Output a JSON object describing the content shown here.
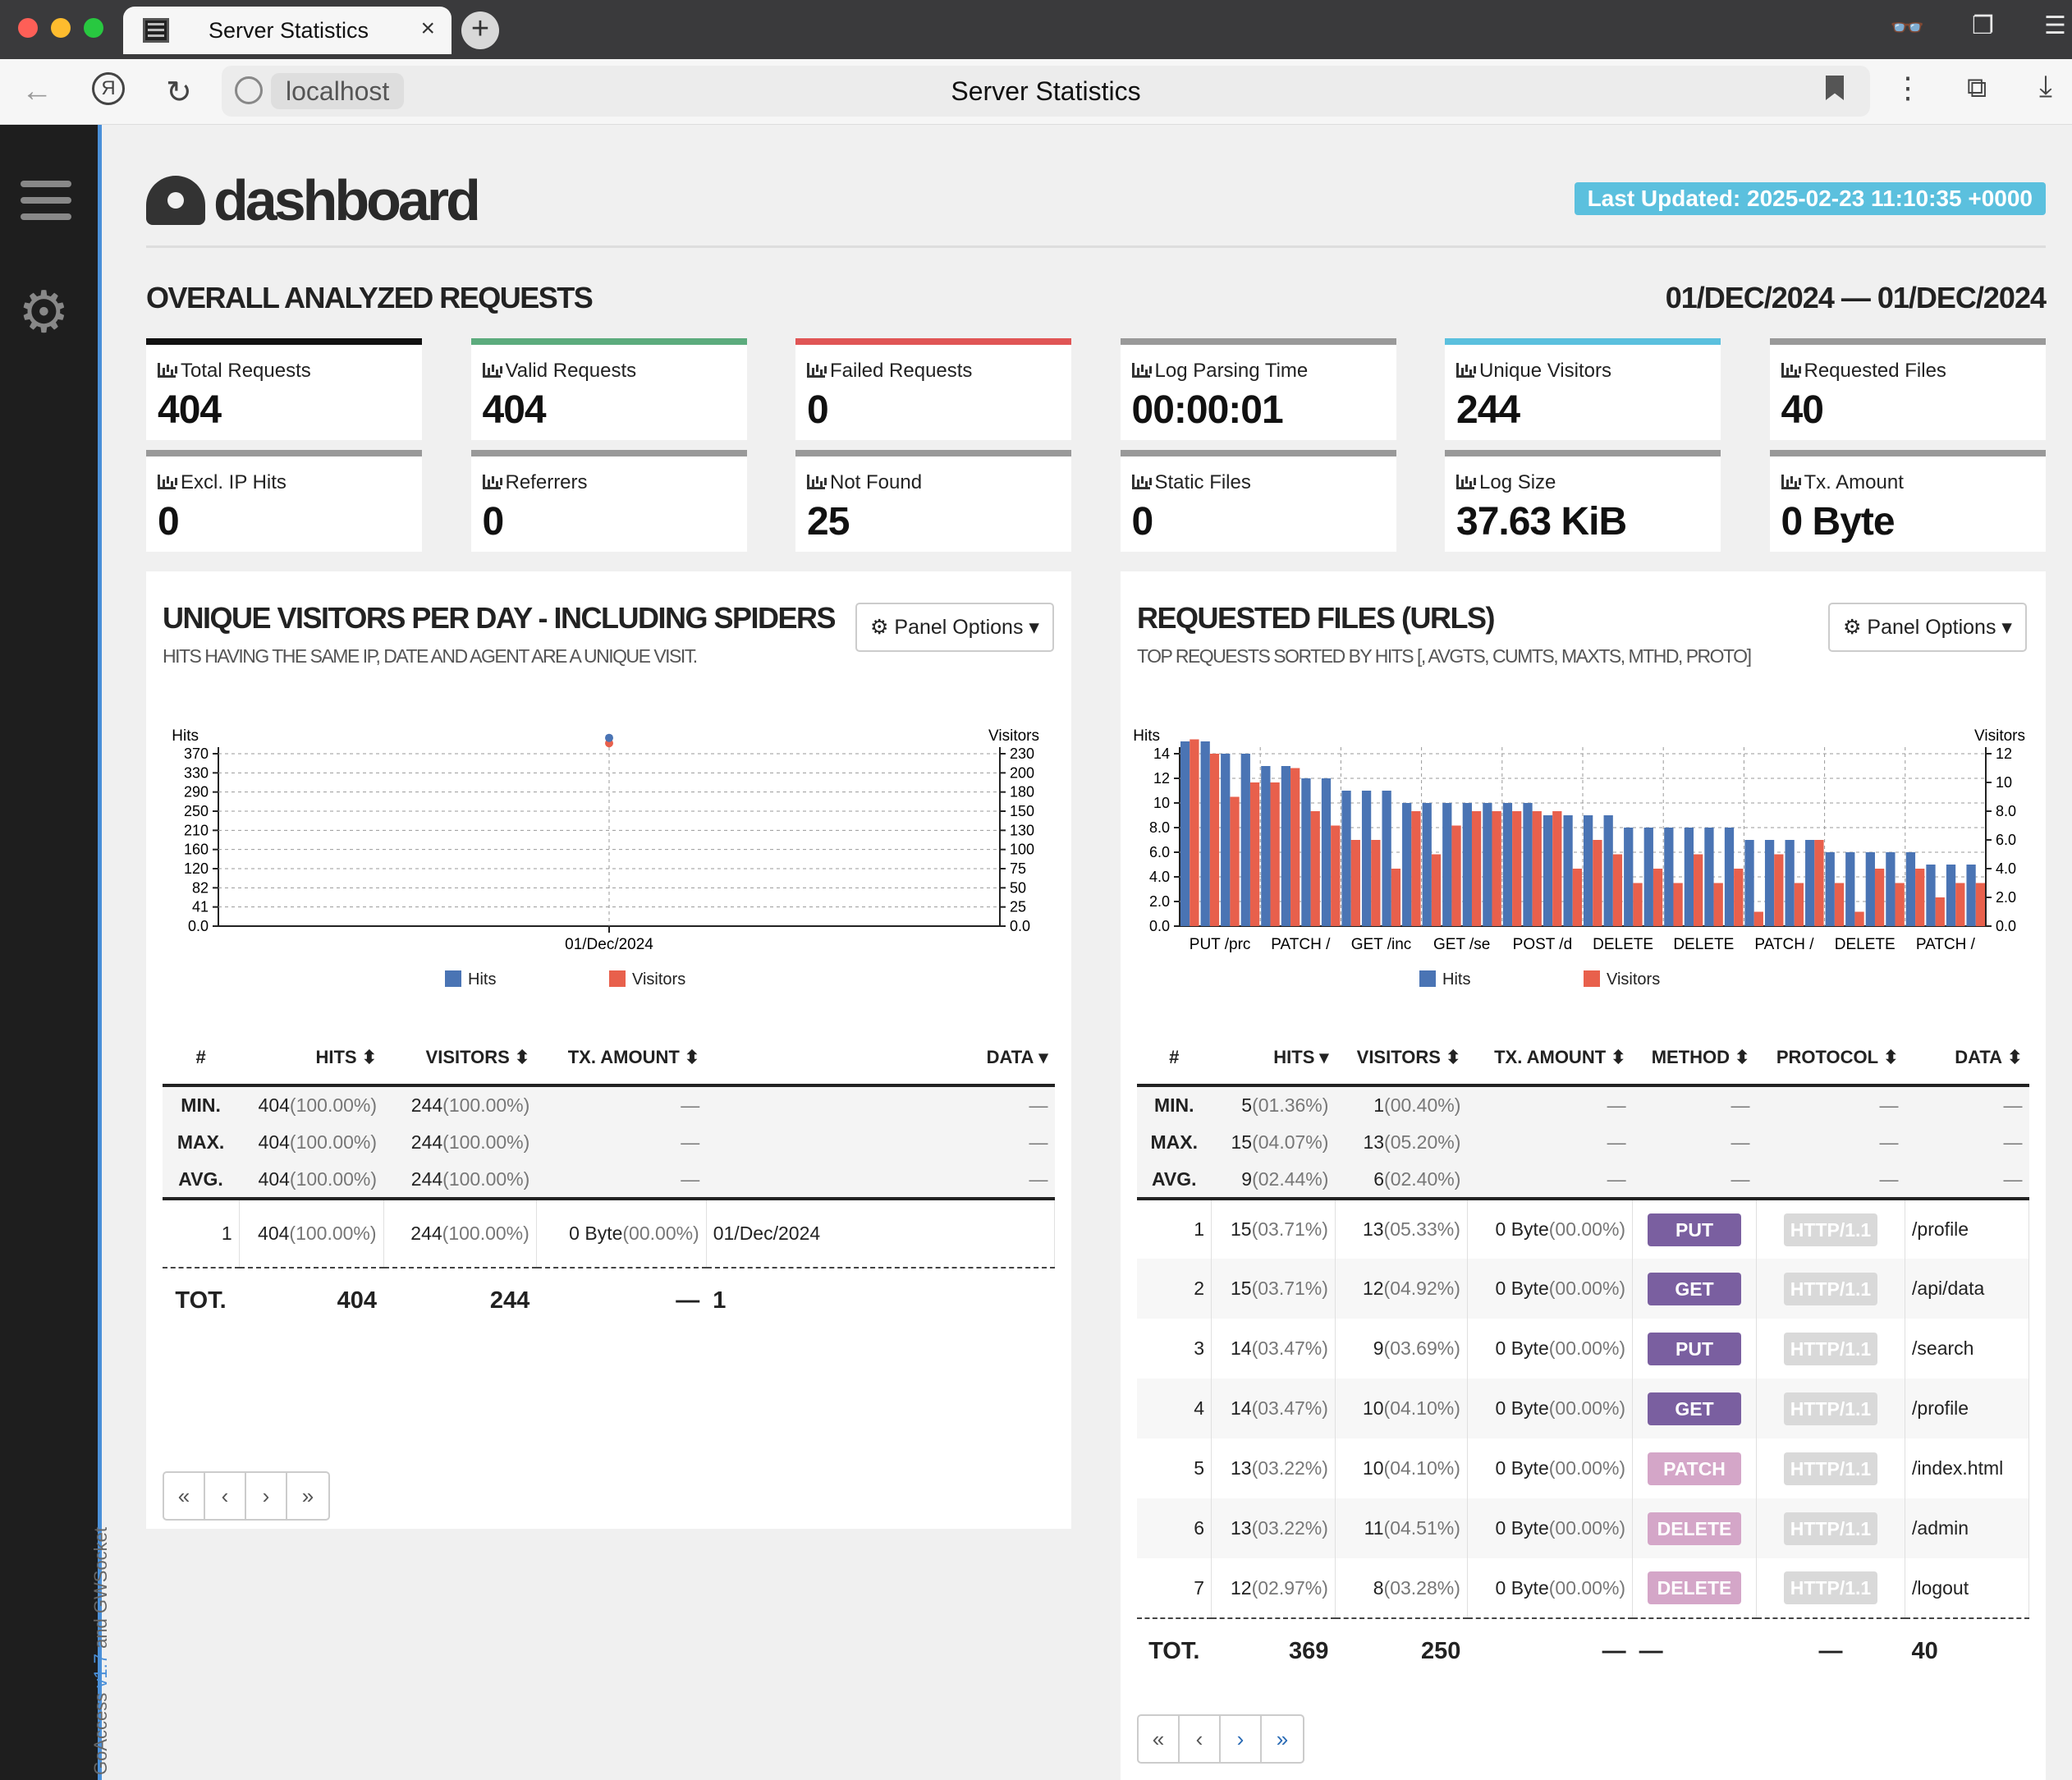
{
  "browser": {
    "tab_title": "Server Statistics",
    "tab_close": "×",
    "new_tab": "+",
    "url": "localhost",
    "page_title": "Server Statistics"
  },
  "sidebar": {
    "credit_prefix": "GoAccess ",
    "credit_version": "v1.7",
    "credit_suffix": " and GWSocket"
  },
  "header": {
    "logo_text": "dashboard",
    "last_updated": "Last Updated: 2025-02-23 11:10:35 +0000"
  },
  "overall": {
    "title": "OVERALL ANALYZED REQUESTS",
    "date_range": "01/DEC/2024 — 01/DEC/2024",
    "cards": [
      {
        "label": "Total Requests",
        "value": "404",
        "color": "#111111"
      },
      {
        "label": "Valid Requests",
        "value": "404",
        "color": "#5cab7d"
      },
      {
        "label": "Failed Requests",
        "value": "0",
        "color": "#e05555"
      },
      {
        "label": "Log Parsing Time",
        "value": "00:00:01",
        "color": "#999999"
      },
      {
        "label": "Unique Visitors",
        "value": "244",
        "color": "#5bc0de"
      },
      {
        "label": "Requested Files",
        "value": "40",
        "color": "#999999"
      },
      {
        "label": "Excl. IP Hits",
        "value": "0",
        "color": "#999999"
      },
      {
        "label": "Referrers",
        "value": "0",
        "color": "#999999"
      },
      {
        "label": "Not Found",
        "value": "25",
        "color": "#999999"
      },
      {
        "label": "Static Files",
        "value": "0",
        "color": "#999999"
      },
      {
        "label": "Log Size",
        "value": "37.63 KiB",
        "color": "#999999"
      },
      {
        "label": "Tx. Amount",
        "value": "0 Byte",
        "color": "#999999"
      }
    ]
  },
  "visitors_panel": {
    "title": "UNIQUE VISITORS PER DAY - INCLUDING SPIDERS",
    "subtitle": "HITS HAVING THE SAME IP, DATE AND AGENT ARE A UNIQUE VISIT.",
    "options": "Panel Options",
    "columns": [
      "#",
      "HITS",
      "VISITORS",
      "TX. AMOUNT",
      "DATA"
    ],
    "stats": [
      {
        "label": "MIN.",
        "hits": "404",
        "hits_pct": "(100.00%)",
        "visitors": "244",
        "visitors_pct": "(100.00%)",
        "tx": "—",
        "data": "—"
      },
      {
        "label": "MAX.",
        "hits": "404",
        "hits_pct": "(100.00%)",
        "visitors": "244",
        "visitors_pct": "(100.00%)",
        "tx": "—",
        "data": "—"
      },
      {
        "label": "AVG.",
        "hits": "404",
        "hits_pct": "(100.00%)",
        "visitors": "244",
        "visitors_pct": "(100.00%)",
        "tx": "—",
        "data": "—"
      }
    ],
    "rows": [
      {
        "n": "1",
        "hits": "404",
        "hits_pct": "(100.00%)",
        "visitors": "244",
        "visitors_pct": "(100.00%)",
        "tx": "0 Byte",
        "tx_pct": "(00.00%)",
        "data": "01/Dec/2024"
      }
    ],
    "total": {
      "label": "TOT.",
      "hits": "404",
      "visitors": "244",
      "tx": "—",
      "data": "1"
    },
    "pager": [
      "«",
      "‹",
      "›",
      "»"
    ]
  },
  "files_panel": {
    "title": "REQUESTED FILES (URLS)",
    "subtitle": "TOP REQUESTS SORTED BY HITS [, AVGTS, CUMTS, MAXTS, MTHD, PROTO]",
    "options": "Panel Options",
    "columns": [
      "#",
      "HITS",
      "VISITORS",
      "TX. AMOUNT",
      "METHOD",
      "PROTOCOL",
      "DATA"
    ],
    "stats": [
      {
        "label": "MIN.",
        "hits": "5",
        "hits_pct": "(01.36%)",
        "visitors": "1",
        "visitors_pct": "(00.40%)"
      },
      {
        "label": "MAX.",
        "hits": "15",
        "hits_pct": "(04.07%)",
        "visitors": "13",
        "visitors_pct": "(05.20%)"
      },
      {
        "label": "AVG.",
        "hits": "9",
        "hits_pct": "(02.44%)",
        "visitors": "6",
        "visitors_pct": "(02.40%)"
      }
    ],
    "dash": "—",
    "rows": [
      {
        "n": "1",
        "hits": "15",
        "hits_pct": "(03.71%)",
        "visitors": "13",
        "visitors_pct": "(05.33%)",
        "tx": "0 Byte",
        "tx_pct": "(00.00%)",
        "method": "PUT",
        "protocol": "HTTP/1.1",
        "data": "/profile"
      },
      {
        "n": "2",
        "hits": "15",
        "hits_pct": "(03.71%)",
        "visitors": "12",
        "visitors_pct": "(04.92%)",
        "tx": "0 Byte",
        "tx_pct": "(00.00%)",
        "method": "GET",
        "protocol": "HTTP/1.1",
        "data": "/api/data"
      },
      {
        "n": "3",
        "hits": "14",
        "hits_pct": "(03.47%)",
        "visitors": "9",
        "visitors_pct": "(03.69%)",
        "tx": "0 Byte",
        "tx_pct": "(00.00%)",
        "method": "PUT",
        "protocol": "HTTP/1.1",
        "data": "/search"
      },
      {
        "n": "4",
        "hits": "14",
        "hits_pct": "(03.47%)",
        "visitors": "10",
        "visitors_pct": "(04.10%)",
        "tx": "0 Byte",
        "tx_pct": "(00.00%)",
        "method": "GET",
        "protocol": "HTTP/1.1",
        "data": "/profile"
      },
      {
        "n": "5",
        "hits": "13",
        "hits_pct": "(03.22%)",
        "visitors": "10",
        "visitors_pct": "(04.10%)",
        "tx": "0 Byte",
        "tx_pct": "(00.00%)",
        "method": "PATCH",
        "protocol": "HTTP/1.1",
        "data": "/index.html"
      },
      {
        "n": "6",
        "hits": "13",
        "hits_pct": "(03.22%)",
        "visitors": "11",
        "visitors_pct": "(04.51%)",
        "tx": "0 Byte",
        "tx_pct": "(00.00%)",
        "method": "DELETE",
        "protocol": "HTTP/1.1",
        "data": "/admin"
      },
      {
        "n": "7",
        "hits": "12",
        "hits_pct": "(02.97%)",
        "visitors": "8",
        "visitors_pct": "(03.28%)",
        "tx": "0 Byte",
        "tx_pct": "(00.00%)",
        "method": "DELETE",
        "protocol": "HTTP/1.1",
        "data": "/logout"
      }
    ],
    "total": {
      "label": "TOT.",
      "hits": "369",
      "visitors": "250",
      "tx": "—",
      "method": "—",
      "protocol": "—",
      "data": "40"
    },
    "pager": [
      "«",
      "‹",
      "›",
      "»"
    ]
  },
  "chart_data": [
    {
      "type": "line",
      "y_left_label": "Hits",
      "y_right_label": "Visitors",
      "y_left_ticks": [
        "0.0",
        "41",
        "82",
        "120",
        "160",
        "210",
        "250",
        "290",
        "330",
        "370"
      ],
      "y_right_ticks": [
        "0.0",
        "25",
        "50",
        "75",
        "100",
        "130",
        "150",
        "180",
        "200",
        "230"
      ],
      "y_left_max": 404,
      "y_right_max": 244,
      "categories": [
        "01/Dec/2024"
      ],
      "series": [
        {
          "name": "Hits",
          "values": [
            404
          ],
          "color": "#4a74b4"
        },
        {
          "name": "Visitors",
          "values": [
            244
          ],
          "color": "#e8604c"
        }
      ],
      "grid": true,
      "legend": "bottom"
    },
    {
      "type": "bar",
      "y_left_label": "Hits",
      "y_right_label": "Visitors",
      "y_left_ticks": [
        "0.0",
        "2.0",
        "4.0",
        "6.0",
        "8.0",
        "10",
        "12",
        "14"
      ],
      "y_right_ticks": [
        "0.0",
        "2.0",
        "4.0",
        "6.0",
        "8.0",
        "10",
        "12"
      ],
      "y_left_max": 15,
      "y_right_max": 13,
      "x_tick_labels": [
        "PUT /prc",
        "PATCH /",
        "GET /inc",
        "GET /se",
        "POST /d",
        "DELETE",
        "DELETE",
        "PATCH /",
        "DELETE",
        "PATCH /"
      ],
      "series": [
        {
          "name": "Hits",
          "color": "#4a74b4",
          "values": [
            15,
            15,
            14,
            14,
            13,
            13,
            12,
            12,
            11,
            11,
            11,
            10,
            10,
            10,
            10,
            10,
            10,
            10,
            9,
            9,
            9,
            9,
            8,
            8,
            8,
            8,
            8,
            8,
            7,
            7,
            7,
            7,
            6,
            6,
            6,
            6,
            6,
            5,
            5,
            5
          ]
        },
        {
          "name": "Visitors",
          "color": "#e8604c",
          "values": [
            13,
            12,
            9,
            10,
            10,
            11,
            8,
            7,
            6,
            6,
            4,
            8,
            5,
            7,
            8,
            8,
            8,
            8,
            8,
            4,
            6,
            5,
            3,
            4,
            3,
            5,
            3,
            4,
            1,
            5,
            3,
            6,
            3,
            1,
            4,
            3,
            4,
            2,
            3,
            3
          ]
        }
      ],
      "grid": true,
      "legend": "bottom"
    }
  ]
}
